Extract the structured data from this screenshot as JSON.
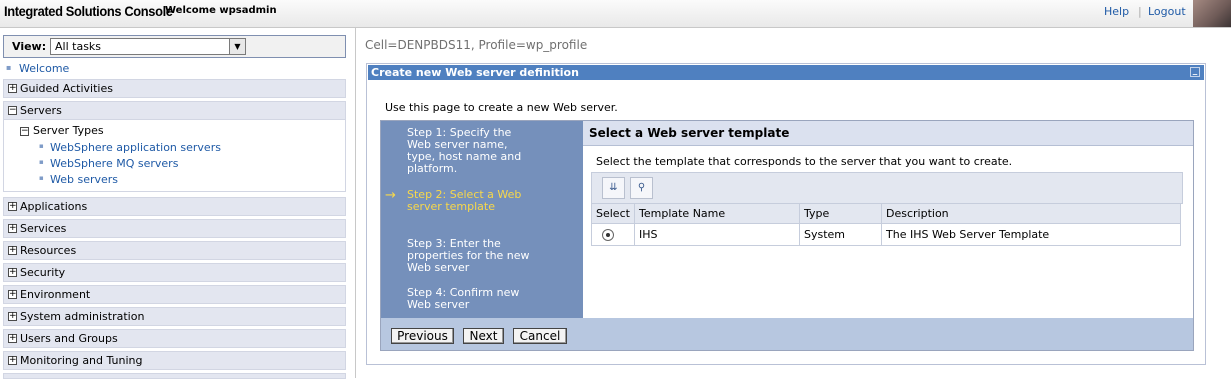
{
  "header": {
    "app_title": "Integrated Solutions Console",
    "welcome": "Welcome wpsadmin",
    "help": "Help",
    "separator": "|",
    "logout": "Logout"
  },
  "nav": {
    "view_label": "View:",
    "view_value": "All tasks",
    "welcome_link": "Welcome",
    "sections": [
      {
        "label": "Guided Activities",
        "expanded": false
      },
      {
        "label": "Servers",
        "expanded": true
      },
      {
        "label": "Applications",
        "expanded": false
      },
      {
        "label": "Services",
        "expanded": false
      },
      {
        "label": "Resources",
        "expanded": false
      },
      {
        "label": "Security",
        "expanded": false
      },
      {
        "label": "Environment",
        "expanded": false
      },
      {
        "label": "System administration",
        "expanded": false
      },
      {
        "label": "Users and Groups",
        "expanded": false
      },
      {
        "label": "Monitoring and Tuning",
        "expanded": false
      }
    ],
    "server_types": {
      "label": "Server Types",
      "links": [
        "WebSphere application servers",
        "WebSphere MQ servers",
        "Web servers"
      ]
    }
  },
  "main": {
    "cell": "Cell=DENPBDS11, Profile=wp_profile",
    "portlet_title": "Create new Web server definition",
    "intro": "Use this page to create a new Web server.",
    "steps": [
      {
        "text": "Step 1: Specify the Web server name, type, host name and platform.",
        "current": false
      },
      {
        "text": "Step 2: Select a Web server template",
        "current": true
      },
      {
        "text": "Step 3: Enter the properties for the new Web server",
        "current": false
      },
      {
        "text": "Step 4: Confirm new Web server",
        "current": false
      }
    ],
    "panel_title": "Select a Web server template",
    "panel_text": "Select the template that corresponds to the server that you want to create.",
    "table": {
      "headers": [
        "Select",
        "Template Name",
        "Type",
        "Description"
      ],
      "rows": [
        {
          "selected": true,
          "name": "IHS",
          "type": "System",
          "description": "The IHS Web Server Template"
        }
      ]
    },
    "buttons": {
      "previous": "Previous",
      "next": "Next",
      "cancel": "Cancel"
    }
  }
}
